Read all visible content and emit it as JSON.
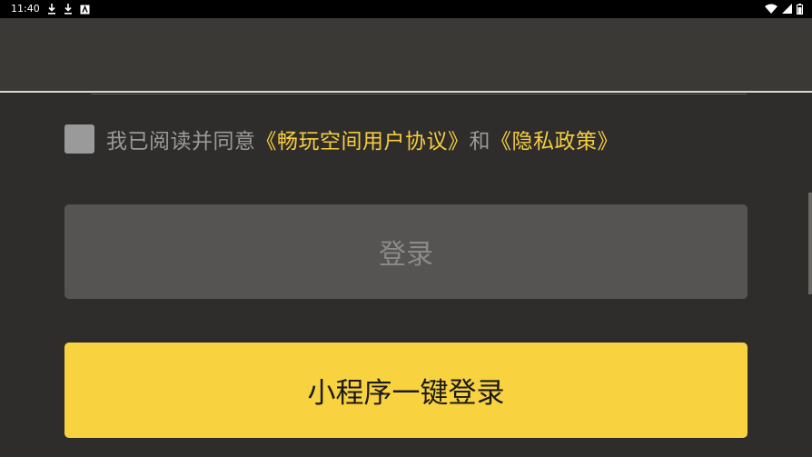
{
  "status_bar": {
    "time": "11:40",
    "left_icons": [
      "download-icon",
      "download-icon",
      "accessibility-icon"
    ],
    "right_icons": [
      "wifi-icon",
      "signal-icon",
      "battery-icon"
    ]
  },
  "agreement": {
    "prefix": "我已阅读并同意",
    "user_agreement_link": "《畅玩空间用户协议》",
    "conjunction": "和",
    "privacy_link": "《隐私政策》",
    "checked": false
  },
  "buttons": {
    "login_label": "登录",
    "mini_program_login_label": "小程序一键登录"
  },
  "colors": {
    "background": "#2e2d2b",
    "header": "#3a3935",
    "link": "#f6cd3e",
    "primary_button": "#f9d240",
    "disabled_button": "#555452"
  }
}
